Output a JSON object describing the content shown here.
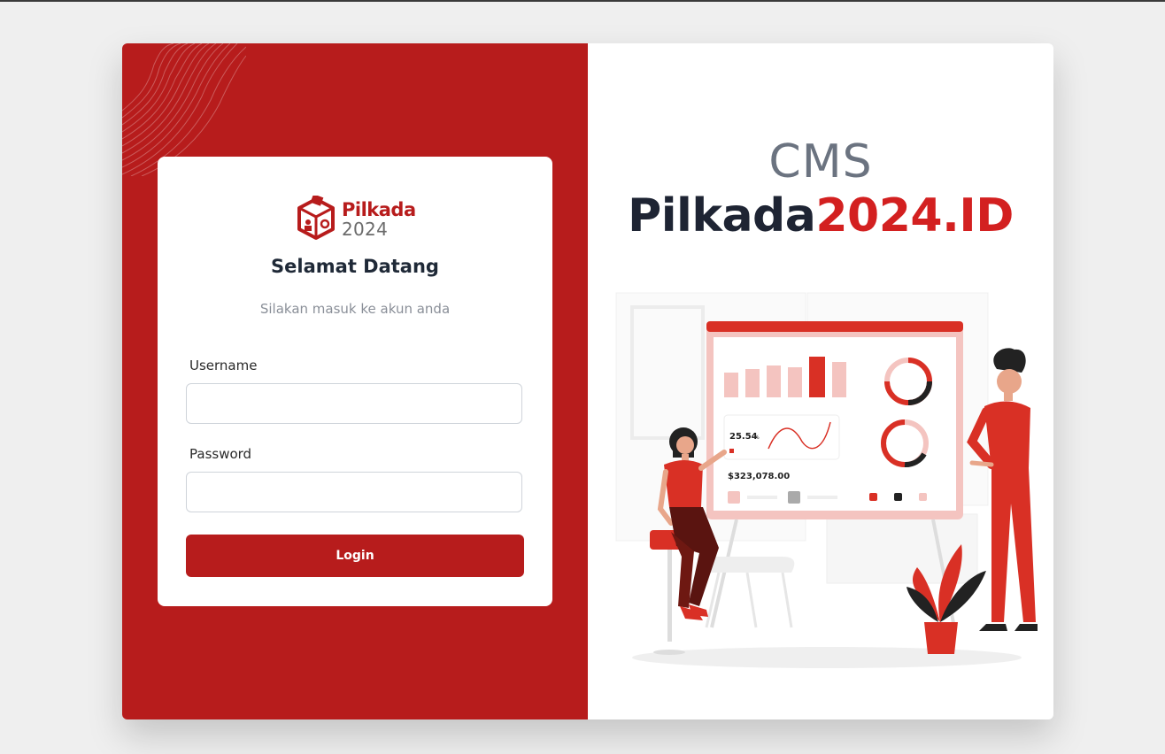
{
  "logo": {
    "word1": "Pilkada",
    "word2": "2024"
  },
  "login": {
    "title": "Selamat Datang",
    "subtitle": "Silakan masuk ke akun anda",
    "username_label": "Username",
    "username_value": "",
    "password_label": "Password",
    "password_value": "",
    "button_label": "Login"
  },
  "hero": {
    "title_top": "CMS",
    "title_part1": "Pilkada",
    "title_part2": "2024.ID"
  },
  "illustration": {
    "percent": "25.54",
    "percent_unit": "%",
    "amount": "$323,078.00"
  },
  "colors": {
    "brand_red": "#b71c1c",
    "accent_red": "#d32020",
    "dark_navy": "#1e2433",
    "gray_text": "#6b7380"
  }
}
